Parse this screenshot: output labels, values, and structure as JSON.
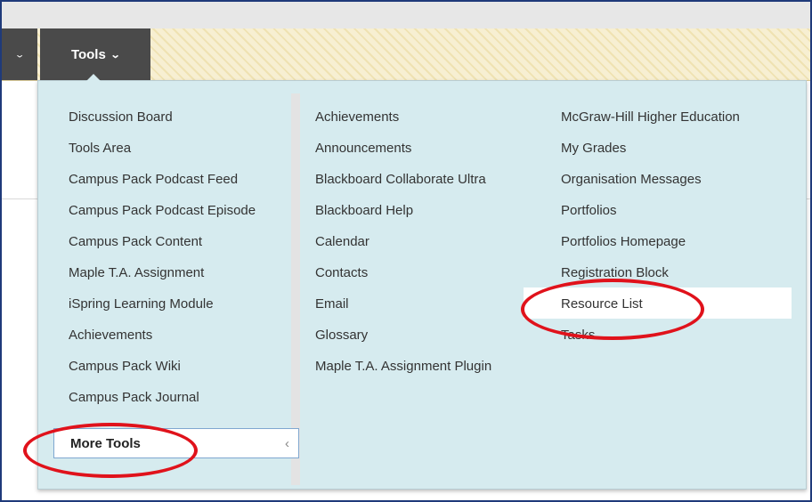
{
  "nav": {
    "prev_tab_icon": "chevron-down-icon",
    "tools_label": "Tools",
    "tools_icon": "chevron-down-icon",
    "tools_chevron": "⌄"
  },
  "menu": {
    "column1": [
      "Discussion Board",
      "Tools Area",
      "Campus Pack Podcast Feed",
      "Campus Pack Podcast Episode",
      "Campus Pack Content",
      "Maple T.A. Assignment",
      "iSpring Learning Module",
      "Achievements",
      "Campus Pack Wiki",
      "Campus Pack Journal"
    ],
    "column2": [
      "Achievements",
      "Announcements",
      "Blackboard Collaborate Ultra",
      "Blackboard Help",
      "Calendar",
      "Contacts",
      "Email",
      "Glossary",
      "Maple T.A. Assignment Plugin"
    ],
    "column3": [
      "McGraw-Hill Higher Education",
      "My Grades",
      "Organisation Messages",
      "Portfolios",
      "Portfolios Homepage",
      "Registration Block",
      "Resource List",
      "Tasks"
    ],
    "more_tools_label": "More Tools",
    "more_tools_icon": "chevron-left-icon"
  },
  "colors": {
    "dropdown_bg": "#d6ebef",
    "nav_tab_bg": "#4a4a4a",
    "annotation_red": "#e0121b"
  }
}
